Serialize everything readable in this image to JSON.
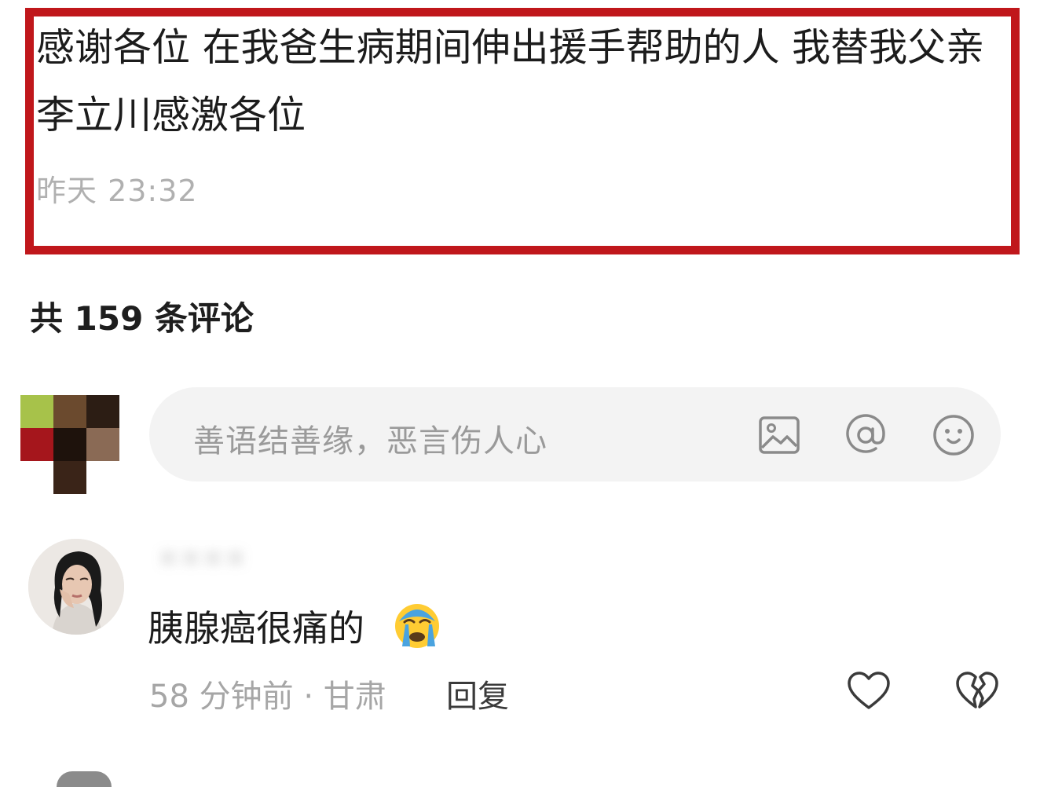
{
  "post": {
    "text": "感谢各位 在我爸生病期间伸出援手帮助的人 我替我父亲李立川感激各位",
    "time": "昨天 23:32",
    "highlight_color": "#c0171b"
  },
  "comments_header": {
    "count_label": "共 159 条评论"
  },
  "composer": {
    "placeholder": "善语结善缘，恶言伤人心",
    "icons": [
      "image-icon",
      "at-icon",
      "emoji-icon"
    ]
  },
  "comments": [
    {
      "username": "××××",
      "text": "胰腺癌很痛的",
      "emoji": "crying-face-emoji",
      "meta": "58 分钟前 · 甘肃",
      "reply_label": "回复",
      "icons": [
        "heart-icon",
        "broken-heart-icon"
      ]
    }
  ]
}
